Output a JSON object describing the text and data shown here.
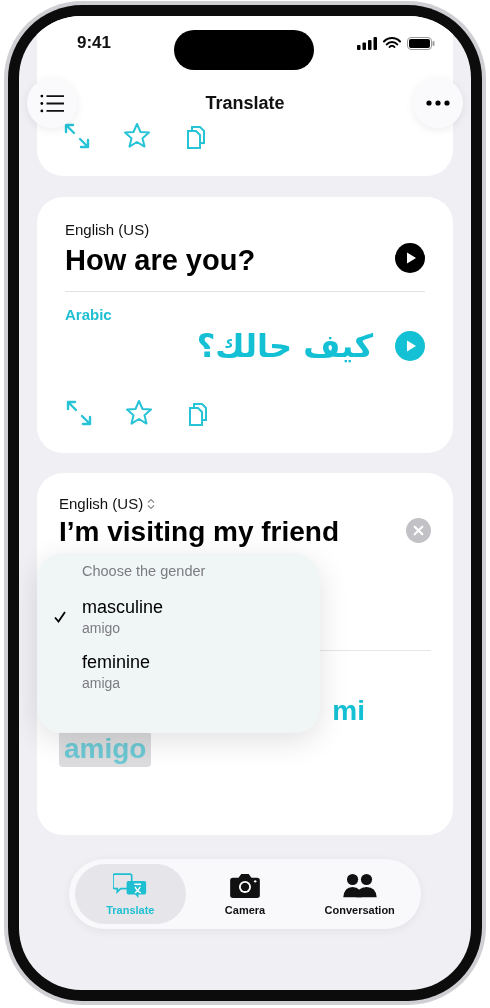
{
  "status_bar": {
    "time": "9:41"
  },
  "nav": {
    "title": "Translate"
  },
  "translation_card": {
    "source_language": "English (US)",
    "source_text": "How are you?",
    "target_language": "Arabic",
    "target_text": "كيف حالك؟"
  },
  "input_card": {
    "source_language": "English (US)",
    "source_text": "I’m visiting my friend",
    "translation_visible": "mi",
    "translation_highlighted": "amigo"
  },
  "gender_menu": {
    "title": "Choose the gender",
    "options": [
      {
        "label": "masculine",
        "word": "amigo",
        "selected": true
      },
      {
        "label": "feminine",
        "word": "amiga",
        "selected": false
      }
    ]
  },
  "tab_bar": [
    {
      "kind": "translate",
      "label": "Translate",
      "selected": true
    },
    {
      "kind": "camera",
      "label": "Camera",
      "selected": false
    },
    {
      "kind": "people",
      "label": "Conversation",
      "selected": false
    }
  ]
}
